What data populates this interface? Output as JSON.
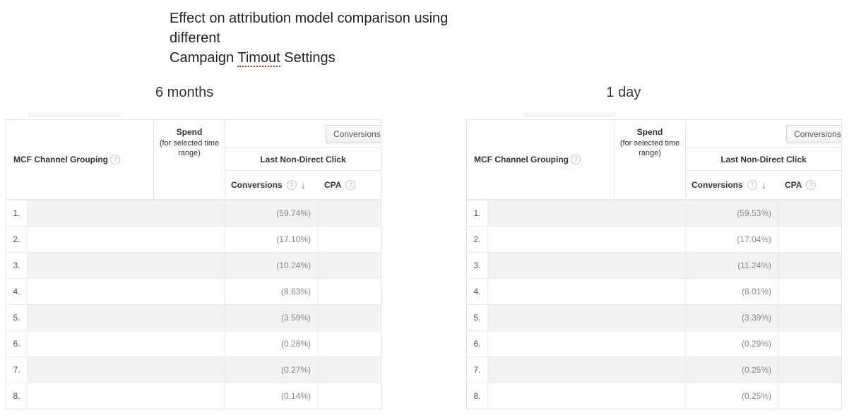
{
  "title_line1": "Effect on attribution model comparison using different",
  "title_line2_a": "Campaign ",
  "title_typo": "Timout",
  "title_line2_b": " Settings",
  "label_left": "6 months",
  "label_right": "1 day",
  "headers": {
    "mcf": "MCF Channel Grouping",
    "spend_label": "Spend",
    "spend_sub": "(for selected time range)",
    "model": "Last Non-Direct Click",
    "conversions": "Conversions",
    "cpa": "CPA",
    "conversions_btn": "Conversions",
    "conversions_btn_right": "Conversions &"
  },
  "left_table": {
    "rows": [
      {
        "index": "1.",
        "conv": "(59.74%)"
      },
      {
        "index": "2.",
        "conv": "(17.10%)"
      },
      {
        "index": "3.",
        "conv": "(10.24%)"
      },
      {
        "index": "4.",
        "conv": "(8.63%)"
      },
      {
        "index": "5.",
        "conv": "(3.59%)"
      },
      {
        "index": "6.",
        "conv": "(0.28%)"
      },
      {
        "index": "7.",
        "conv": "(0.27%)"
      },
      {
        "index": "8.",
        "conv": "(0.14%)"
      }
    ]
  },
  "right_table": {
    "rows": [
      {
        "index": "1.",
        "conv": "(59.53%)"
      },
      {
        "index": "2.",
        "conv": "(17.04%)"
      },
      {
        "index": "3.",
        "conv": "(11.24%)"
      },
      {
        "index": "4.",
        "conv": "(8.01%)"
      },
      {
        "index": "5.",
        "conv": "(3.39%)"
      },
      {
        "index": "6.",
        "conv": "(0.29%)"
      },
      {
        "index": "7.",
        "conv": "(0.25%)"
      },
      {
        "index": "8.",
        "conv": "(0.25%)"
      }
    ]
  }
}
